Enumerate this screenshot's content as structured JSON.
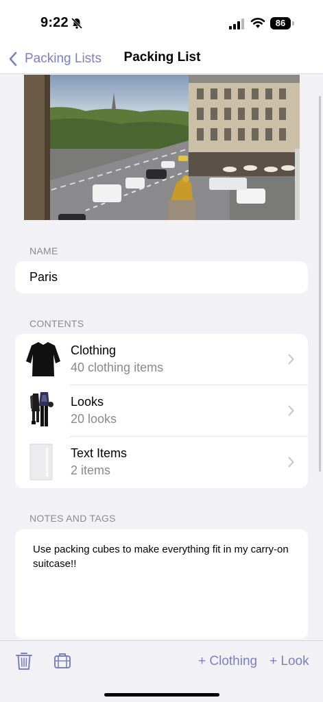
{
  "status_bar": {
    "time": "9:22",
    "battery": "86",
    "icons": [
      "bell-slash-icon",
      "cellular-signal-icon",
      "wifi-icon",
      "battery-icon"
    ]
  },
  "nav": {
    "back_label": "Packing Lists",
    "title": "Packing List"
  },
  "colors": {
    "accent": "#7c7fc2",
    "background": "#f2f1f6",
    "secondary_text": "#8a8a8e"
  },
  "name_section": {
    "label": "NAME",
    "value": "Paris"
  },
  "contents_section": {
    "label": "CONTENTS",
    "rows": [
      {
        "title": "Clothing",
        "subtitle": "40 clothing items",
        "icon": "black-dress-thumbnail"
      },
      {
        "title": "Looks",
        "subtitle": "20 looks",
        "icon": "outfits-thumbnail"
      },
      {
        "title": "Text Items",
        "subtitle": "2 items",
        "icon": "text-item-thumbnail"
      }
    ]
  },
  "notes_section": {
    "label": "NOTES AND TAGS",
    "text": "Use packing cubes to make everything fit in my carry-on suitcase!!"
  },
  "toolbar": {
    "add_clothing": "+ Clothing",
    "add_look": "+ Look",
    "icons": [
      "trash-icon",
      "suitcase-icon"
    ]
  }
}
